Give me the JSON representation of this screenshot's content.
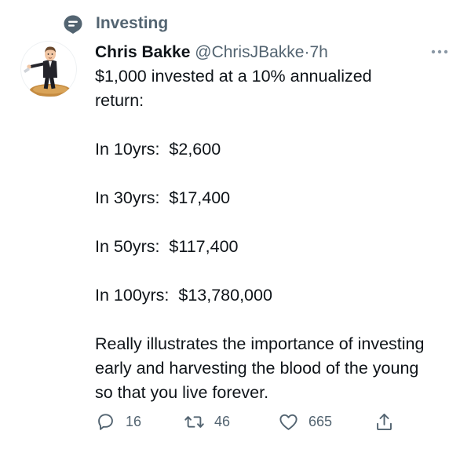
{
  "context": {
    "label": "Investing",
    "icon": "speech-bubble-icon"
  },
  "tweet": {
    "author_name": "Chris Bakke",
    "author_handle": "@ChrisJBakke",
    "separator": "·",
    "time": "7h",
    "avatar": "avatar-cartoon-man-icon",
    "more_icon": "more-dots-icon",
    "paragraphs": {
      "intro": "$1,000 invested at a 10% annualized return:",
      "y10": "In 10yrs:  $2,600",
      "y30": "In 30yrs:  $17,400",
      "y50": "In 50yrs:  $117,400",
      "y100": "In 100yrs:  $13,780,000",
      "outro": "Really illustrates the importance of investing early and harvesting the blood of the young so that you live forever."
    }
  },
  "actions": {
    "reply": {
      "icon": "reply-icon",
      "count": "16"
    },
    "retweet": {
      "icon": "retweet-icon",
      "count": "46"
    },
    "like": {
      "icon": "heart-icon",
      "count": "665"
    },
    "share": {
      "icon": "share-icon"
    }
  },
  "colors": {
    "text": "#0f1419",
    "secondary": "#536471",
    "background": "#ffffff"
  }
}
